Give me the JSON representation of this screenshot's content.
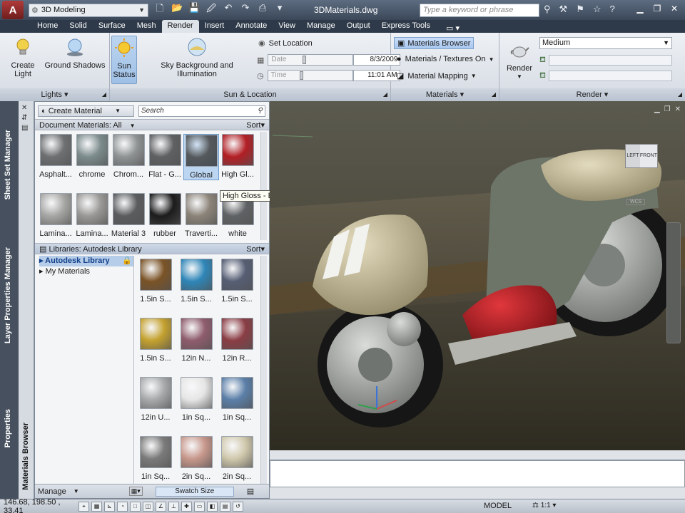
{
  "titlebar": {
    "logo": "A",
    "workspace": "3D Modeling",
    "document_title": "3DMaterials.dwg",
    "search_placeholder": "Type a keyword or phrase",
    "help": "?"
  },
  "ribbon_tabs": [
    "Home",
    "Solid",
    "Surface",
    "Mesh",
    "Render",
    "Insert",
    "Annotate",
    "View",
    "Manage",
    "Output",
    "Express Tools"
  ],
  "active_tab": "Render",
  "ribbon": {
    "lights": {
      "create_light": [
        "Create",
        "Light"
      ],
      "ground_shadows": "Ground Shadows",
      "title": "Lights"
    },
    "sun": {
      "sun_status": [
        "Sun",
        "Status"
      ],
      "sky": "Sky Background and Illumination",
      "set_location": "Set Location",
      "date_label": "Date",
      "date_value": "8/3/2009",
      "time_label": "Time",
      "time_value": "11:01 AM",
      "title": "Sun & Location"
    },
    "materials": {
      "browser": "Materials Browser",
      "textures": "Materials / Textures On",
      "mapping": "Material Mapping",
      "title": "Materials"
    },
    "render": {
      "render_label": "Render",
      "quality": "Medium",
      "title": "Render"
    }
  },
  "left_tabs": {
    "sheet_set": "Sheet Set Manager",
    "layer_props": "Layer Properties Manager",
    "properties": "Properties"
  },
  "materials_browser": {
    "title": "Materials Browser",
    "create_material": "Create Material",
    "search": "Search",
    "doc_section": "Document Materials: All",
    "sort": "Sort",
    "doc_materials": [
      {
        "label": "Asphalt...",
        "color": "#6d6f71"
      },
      {
        "label": "chrome",
        "color": "#7c8b8c"
      },
      {
        "label": "Chrom...",
        "color": "#8f9394"
      },
      {
        "label": "Flat - G...",
        "color": "#5f6062"
      },
      {
        "label": "Global",
        "color": "#55595c"
      },
      {
        "label": "High Gl...",
        "color": "#b21e24"
      },
      {
        "label": "Lamina...",
        "color": "#a6a6a4"
      },
      {
        "label": "Lamina...",
        "color": "#9a9896"
      },
      {
        "label": "Material 3",
        "color": "#5a5c5e"
      },
      {
        "label": "rubber",
        "color": "#1c1c1c"
      },
      {
        "label": "Traverti...",
        "color": "#8c8479"
      },
      {
        "label": "white",
        "color": "#5f6264"
      }
    ],
    "tooltip": "High Gloss - Burnt Red",
    "lib_section": "Libraries: Autodesk Library",
    "tree": [
      "Autodesk Library",
      "My Materials"
    ],
    "lib_materials": [
      {
        "label": "1.5in S...",
        "color": "#7a5326"
      },
      {
        "label": "1.5in S...",
        "color": "#2e86b8"
      },
      {
        "label": "1.5in S...",
        "color": "#565e74"
      },
      {
        "label": "1.5in S...",
        "color": "#c4a12e"
      },
      {
        "label": "12in N...",
        "color": "#8f5c6c"
      },
      {
        "label": "12in R...",
        "color": "#8a3d44"
      },
      {
        "label": "12in U...",
        "color": "#a7a9ab"
      },
      {
        "label": "1in Sq...",
        "color": "#e6e6e6"
      },
      {
        "label": "1in Sq...",
        "color": "#5b7fa8"
      },
      {
        "label": "1in Sq...",
        "color": "#7a7a7a"
      },
      {
        "label": "2in Sq...",
        "color": "#c7978b"
      },
      {
        "label": "2in Sq...",
        "color": "#d0c8ac"
      }
    ],
    "manage": "Manage",
    "swatch_size": "Swatch Size"
  },
  "viewport": {
    "viewcube": {
      "left": "LEFT",
      "front": "FRONT"
    },
    "wcs": "WCS"
  },
  "status": {
    "coords": "146.68, 198.50 , 33.41",
    "model": "MODEL",
    "scale": "1:1"
  }
}
